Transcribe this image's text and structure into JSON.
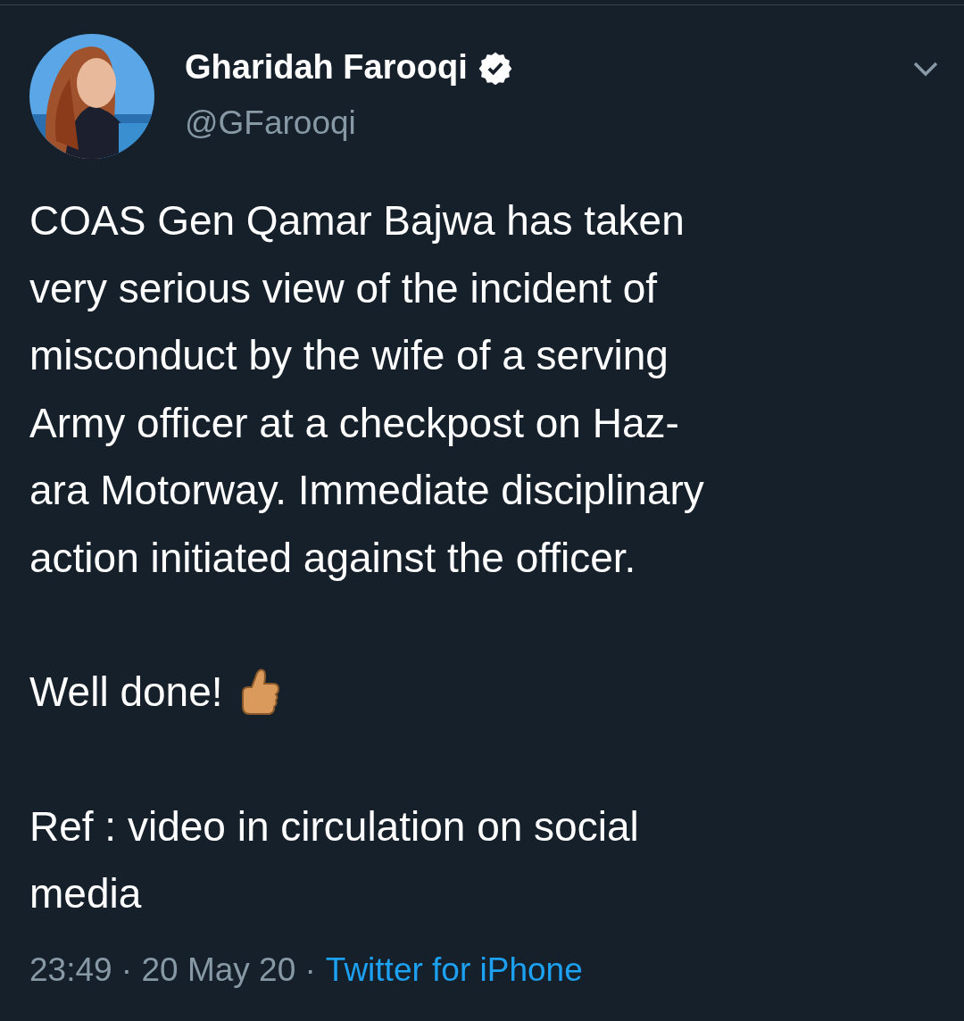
{
  "author": {
    "name": "Gharidah Farooqi",
    "verified": true,
    "handle": "@GFarooqi"
  },
  "tweet": {
    "paragraphs": [
      {
        "kind": "plain",
        "text": "COAS Gen Qamar Bajwa has taken\nvery serious view of the incident of\nmisconduct by the wife of a serving\nArmy officer at a checkpost on Haz-\nara Motorway. Immediate disciplinary\naction initiated against the officer."
      },
      {
        "kind": "thumbs-up",
        "text": "Well done!"
      },
      {
        "kind": "plain",
        "text": "Ref : video in circulation on social\nmedia"
      }
    ]
  },
  "meta": {
    "timestamp": "23:49 · 20 May 20 ·",
    "source": "Twitter for iPhone"
  }
}
